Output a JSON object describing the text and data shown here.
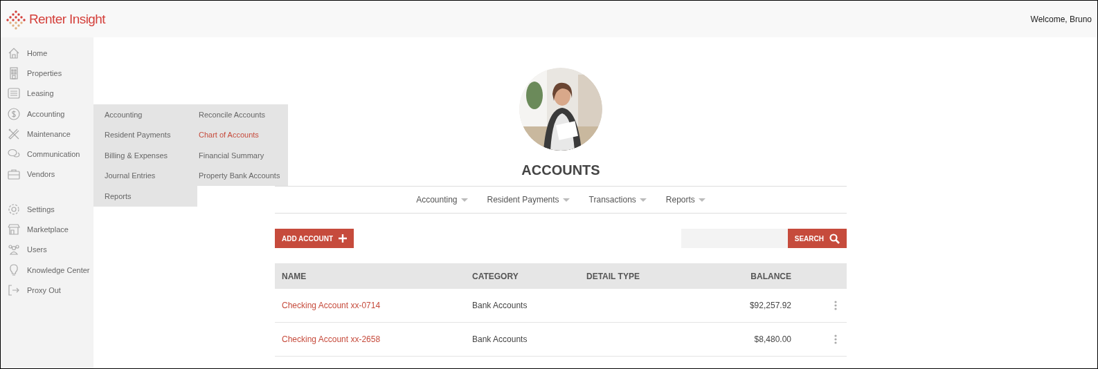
{
  "header": {
    "logo_text": "Renter Insight",
    "welcome": "Welcome, Bruno"
  },
  "sidebar": {
    "sections": [
      {
        "items": [
          {
            "label": "Home"
          },
          {
            "label": "Properties"
          },
          {
            "label": "Leasing"
          },
          {
            "label": "Accounting"
          },
          {
            "label": "Maintenance"
          },
          {
            "label": "Communication"
          },
          {
            "label": "Vendors"
          }
        ]
      },
      {
        "items": [
          {
            "label": "Settings"
          },
          {
            "label": "Marketplace"
          },
          {
            "label": "Users"
          },
          {
            "label": "Knowledge Center"
          },
          {
            "label": "Proxy Out"
          }
        ]
      }
    ]
  },
  "flyout_menu": {
    "items": [
      {
        "label": "Accounting"
      },
      {
        "label": "Resident Payments"
      },
      {
        "label": "Billing & Expenses"
      },
      {
        "label": "Journal Entries"
      },
      {
        "label": "Reports"
      }
    ]
  },
  "flyout_submenu": {
    "items": [
      {
        "label": "Reconcile Accounts",
        "selected": false
      },
      {
        "label": "Chart of Accounts",
        "selected": true
      },
      {
        "label": "Financial Summary",
        "selected": false
      },
      {
        "label": "Property Bank Accounts",
        "selected": false
      }
    ]
  },
  "page": {
    "title": "ACCOUNTS"
  },
  "subnav": [
    {
      "label": "Accounting"
    },
    {
      "label": "Resident Payments"
    },
    {
      "label": "Transactions"
    },
    {
      "label": "Reports"
    }
  ],
  "toolbar": {
    "add_button": "ADD ACCOUNT",
    "search_button": "SEARCH"
  },
  "table": {
    "columns": [
      "NAME",
      "CATEGORY",
      "DETAIL TYPE",
      "BALANCE"
    ],
    "rows": [
      {
        "name": "Checking Account xx-0714",
        "category": "Bank Accounts",
        "balance": "$92,257.92"
      },
      {
        "name": "Checking Account xx-2658",
        "category": "Bank Accounts",
        "balance": "$8,480.00"
      }
    ]
  }
}
